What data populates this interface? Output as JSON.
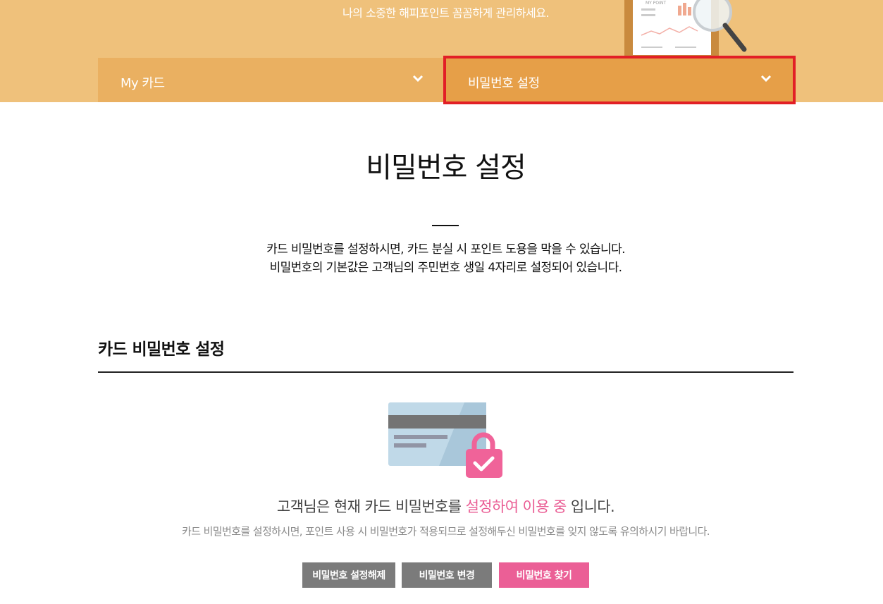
{
  "banner": {
    "tagline": "나의 소중한 해피포인트 꼼꼼하게 관리하세요.",
    "illustration_text": "MY POINT"
  },
  "nav": {
    "tabs": [
      {
        "label": "My 카드",
        "icon": "chevron-down-icon",
        "selected": false
      },
      {
        "label": "비밀번호 설정",
        "icon": "chevron-down-icon",
        "selected": true
      }
    ]
  },
  "page": {
    "title": "비밀번호 설정",
    "intro_line1": "카드 비밀번호를 설정하시면, 카드 분실 시 포인트 도용을 막을 수 있습니다.",
    "intro_line2": "비밀번호의 기본값은 고객님의 주민번호 생일 4자리로 설정되어 있습니다."
  },
  "section": {
    "heading": "카드 비밀번호 설정",
    "illustration_icon": "card-lock-icon",
    "status_prefix": "고객님은 현재 카드 비밀번호를",
    "status_highlight": "설정하여 이용 중",
    "status_suffix": "입니다.",
    "notice": "카드 비밀번호를 설정하시면, 포인트 사용 시 비밀번호가 적용되므로 설정해두신 비밀번호를 잊지 않도록 유의하시기 바랍니다."
  },
  "buttons": {
    "unset": "비밀번호 설정해제",
    "change": "비밀번호 변경",
    "find": "비밀번호 찾기"
  },
  "colors": {
    "banner_bg": "#efc17b",
    "tab_bg": "#eab061",
    "tab_selected_bg": "#e69f48",
    "selection_outline": "#e21f26",
    "highlight_pink": "#ea5d94",
    "button_gray": "#7b7b7b",
    "button_pink": "#eb5f96"
  }
}
